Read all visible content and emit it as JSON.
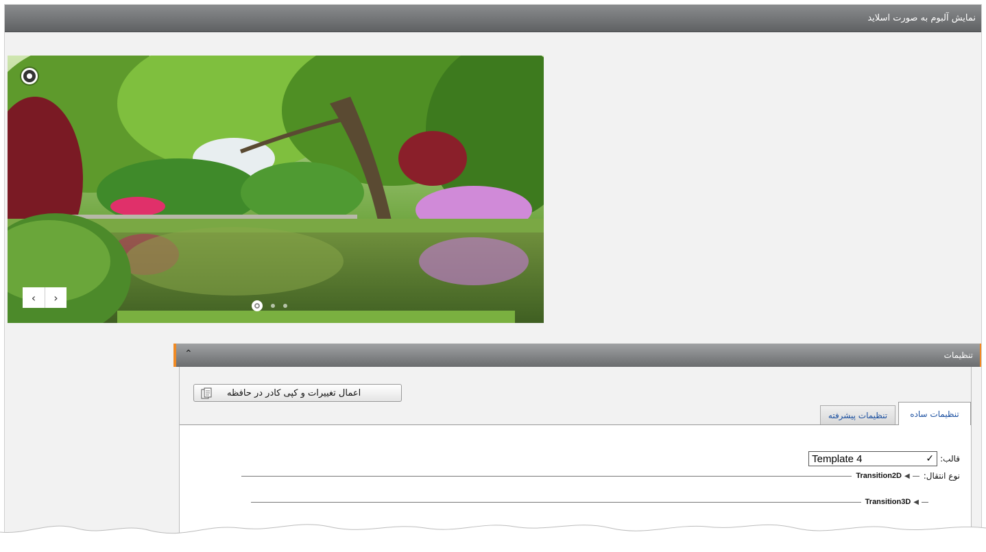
{
  "window": {
    "title": "نمایش آلبوم به صورت اسلاید"
  },
  "slider": {
    "image": "park-pond-landscape",
    "play_icon": "play-pause-icon",
    "prev_symbol": "‹",
    "next_symbol": "›",
    "slide_count": 3,
    "active_slide": 1
  },
  "settings": {
    "title": "تنظیمات",
    "collapse_symbol": "⌃",
    "copy_button_label": "اعمال تغییرات و کپی کادر در حافظه",
    "tabs": {
      "simple": "تنظیمات ساده",
      "advanced": "تنظیمات پیشرفته"
    },
    "template_label": "قالب:",
    "template_value": "Template 4",
    "transition_label": "نوع انتقال:",
    "transition_2d": "Transition2D",
    "transition_3d": "Transition3D"
  },
  "colors": {
    "accent": "#f08a24",
    "tab_text": "#1a4fa0",
    "titlebar": "#6b6d6f"
  }
}
